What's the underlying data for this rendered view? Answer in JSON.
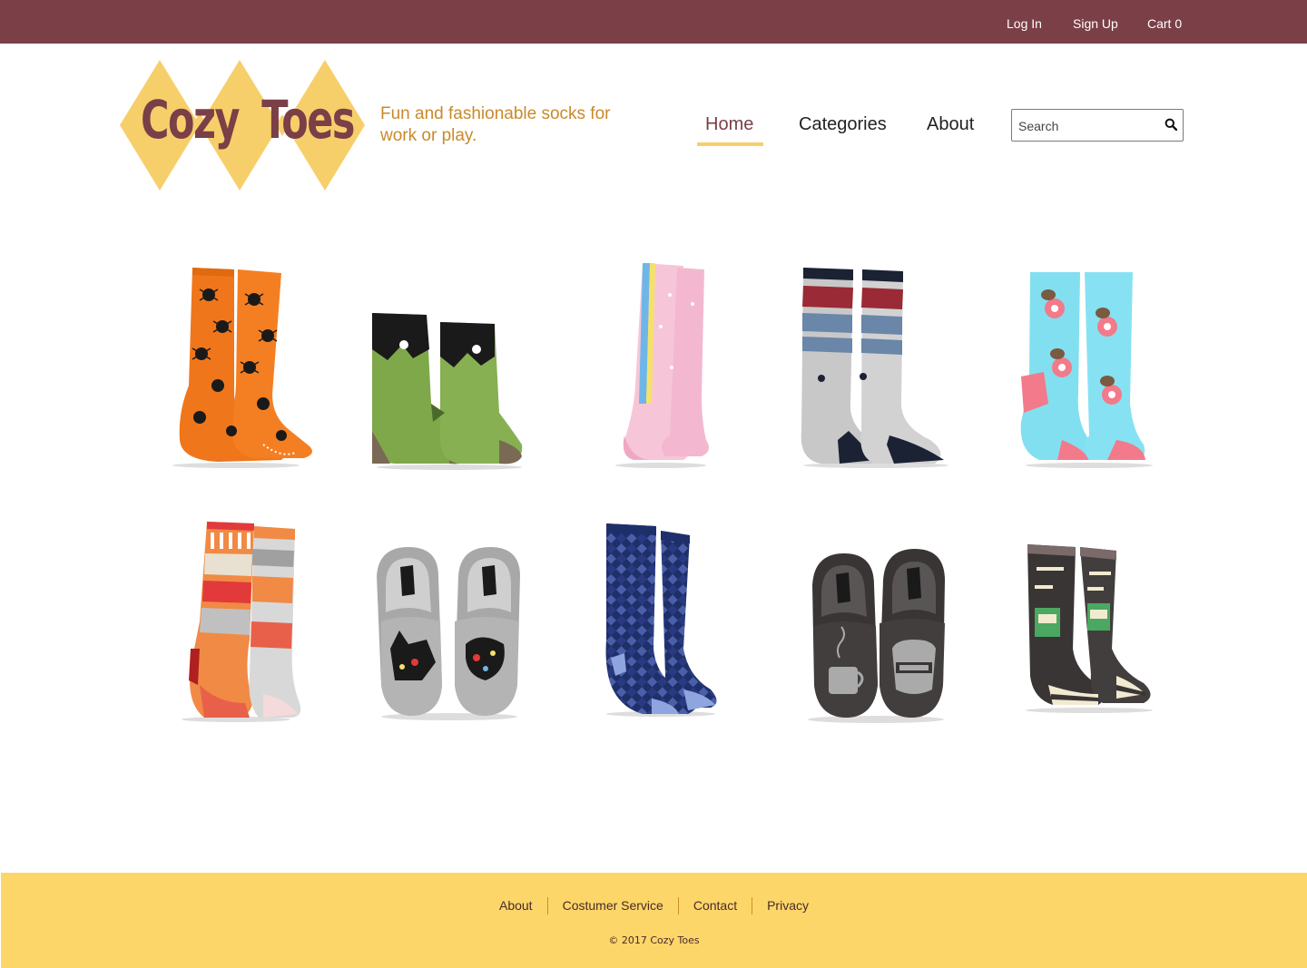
{
  "topbar": {
    "login": "Log In",
    "signup": "Sign Up",
    "cart": "Cart 0"
  },
  "brand": {
    "logo_word1": "Cozy",
    "logo_word2": "Toes",
    "tagline": "Fun and fashionable socks for work or play."
  },
  "nav": {
    "home": "Home",
    "categories": "Categories",
    "about": "About",
    "active": "Home"
  },
  "search": {
    "placeholder": "Search"
  },
  "products": [
    {
      "kind": "spider-socks",
      "colors": [
        "#f0761b",
        "#1a1a1a",
        "#ffffff"
      ]
    },
    {
      "kind": "frankenstein-socks",
      "colors": [
        "#7ea84a",
        "#1a1a1a",
        "#7a6a55"
      ]
    },
    {
      "kind": "unicorn-knee-socks",
      "colors": [
        "#f6c6d8",
        "#6fb6e8",
        "#f5e16a"
      ]
    },
    {
      "kind": "striped-athletic-socks",
      "colors": [
        "#c8c8c8",
        "#9a2a35",
        "#6a86a8",
        "#1a2233"
      ]
    },
    {
      "kind": "sloth-donut-socks",
      "colors": [
        "#82dff0",
        "#f27a8a",
        "#7a5a40"
      ]
    },
    {
      "kind": "nordic-pattern-socks",
      "colors": [
        "#f08a45",
        "#e23a3a",
        "#c0c0c0"
      ]
    },
    {
      "kind": "cat-slippers",
      "colors": [
        "#a8a8a8",
        "#1a1a1a",
        "#e23a3a"
      ]
    },
    {
      "kind": "argyle-socks",
      "colors": [
        "#1f2f6a",
        "#8fa5e0",
        "#4a5fa8"
      ]
    },
    {
      "kind": "coffee-slippers",
      "colors": [
        "#3a3535",
        "#aaaaaa",
        "#1a1a1a"
      ]
    },
    {
      "kind": "sunday-socks",
      "colors": [
        "#3a3535",
        "#f2ead0",
        "#4aa860"
      ]
    }
  ],
  "footer": {
    "links": [
      "About",
      "Costumer Service",
      "Contact",
      "Privacy"
    ],
    "copyright": "© 2017 Cozy Toes"
  },
  "colors": {
    "topbar": "#7a3f47",
    "accent": "#f7cf6a",
    "footer": "#fcd669",
    "tagline": "#c88a2a"
  }
}
